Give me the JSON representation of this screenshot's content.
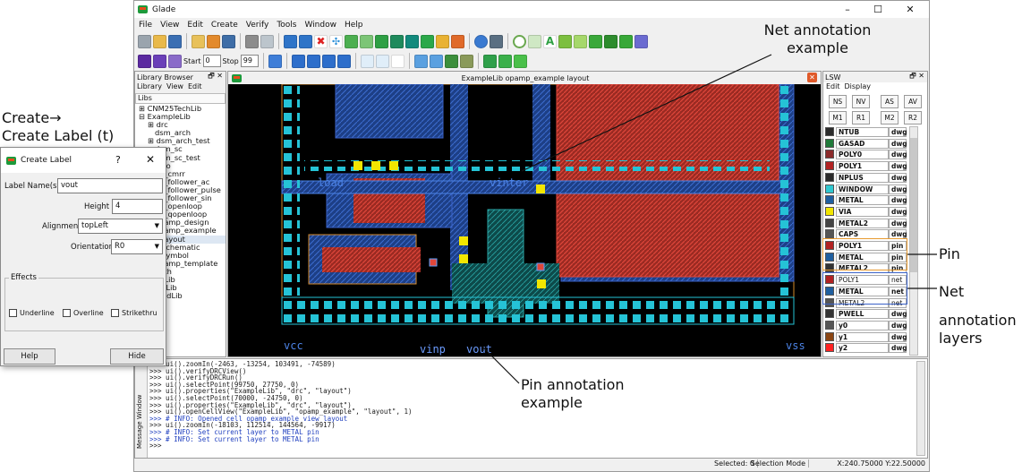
{
  "window": {
    "title": "Glade",
    "min": "–",
    "max": "☐",
    "close": "✕"
  },
  "menu": [
    "File",
    "View",
    "Edit",
    "Create",
    "Verify",
    "Tools",
    "Window",
    "Help"
  ],
  "toolbar": {
    "start_label": "Start",
    "start_value": "0",
    "stop_label": "Stop",
    "stop_value": "99"
  },
  "library_browser": {
    "title": "Library Browser",
    "pin": "🗗 ✕",
    "menu": [
      "Library",
      "View",
      "Edit"
    ],
    "libs_header": "Libs",
    "items": [
      "CNM25TechLib",
      "ExampleLib",
      "drc",
      "dsm_arch",
      "dsm_arch_test",
      "dsm_sc",
      "dsm_sc_test",
      "galo",
      "ga_cmrr",
      "ga_follower_ac",
      "ga_follower_pulse",
      "ga_follower_sin",
      "ga_openloop",
      "ga_qopenloop",
      "opamp_design",
      "opamp_example",
      "layout",
      "schematic",
      "symbol",
      "opamp_template",
      "path",
      "S3Lib",
      "oleLib",
      "medLib"
    ]
  },
  "canvas": {
    "title": "ExampleLib opamp_example layout",
    "labels": [
      "vinter",
      "load",
      "vcc",
      "vinp",
      "vout",
      "vss"
    ]
  },
  "lsw": {
    "title": "LSW",
    "menu": [
      "Edit",
      "Display"
    ],
    "buttons": [
      "NS",
      "NV",
      "AS",
      "AV",
      "M1",
      "R1",
      "M2",
      "R2"
    ],
    "layers": [
      {
        "name": "NTUB",
        "purpose": "dwg",
        "color": "#2b2b2b"
      },
      {
        "name": "GASAD",
        "purpose": "dwg",
        "color": "#1f7a3a"
      },
      {
        "name": "POLY0",
        "purpose": "dwg",
        "color": "#8b2a2a"
      },
      {
        "name": "POLY1",
        "purpose": "dwg",
        "color": "#b22222"
      },
      {
        "name": "NPLUS",
        "purpose": "dwg",
        "color": "#2a2a2a"
      },
      {
        "name": "WINDOW",
        "purpose": "dwg",
        "color": "#30c8d0"
      },
      {
        "name": "METAL",
        "purpose": "dwg",
        "color": "#1f5fa0"
      },
      {
        "name": "VIA",
        "purpose": "dwg",
        "color": "#f2e600"
      },
      {
        "name": "METAL2",
        "purpose": "dwg",
        "color": "#444444"
      },
      {
        "name": "CAPS",
        "purpose": "dwg",
        "color": "#555555"
      },
      {
        "name": "POLY1",
        "purpose": "pin",
        "color": "#b22222"
      },
      {
        "name": "METAL",
        "purpose": "pin",
        "color": "#1f5fa0"
      },
      {
        "name": "METAL2",
        "purpose": "pin",
        "color": "#333333"
      },
      {
        "name": "POLY1",
        "purpose": "net",
        "color": "#b22222"
      },
      {
        "name": "METAL",
        "purpose": "net",
        "color": "#1f5fa0"
      },
      {
        "name": "METAL2",
        "purpose": "net",
        "color": "#555555"
      },
      {
        "name": "PWELL",
        "purpose": "dwg",
        "color": "#333333"
      },
      {
        "name": "y0",
        "purpose": "dwg",
        "color": "#555555"
      },
      {
        "name": "y1",
        "purpose": "dwg",
        "color": "#8b4513"
      },
      {
        "name": "y2",
        "purpose": "dwg",
        "color": "#ff2222"
      }
    ]
  },
  "dialog": {
    "title": "Create Label",
    "help_q": "?",
    "close": "✕",
    "name_label": "Label Name(s)",
    "name_value": "vout",
    "height_label": "Height",
    "height_value": "4",
    "align_label": "Alignment",
    "align_value": "topLeft",
    "orient_label": "Orientation",
    "orient_value": "R0",
    "effects_label": "Effects",
    "underline": "Underline",
    "overline": "Overline",
    "strikethru": "Strikethru",
    "help_btn": "Help",
    "hide_btn": "Hide"
  },
  "console": {
    "side_label": "Message Window",
    "lines": [
      ">>> ui().zoomIn(-2463, -13254, 103491, -74589)",
      ">>> ui().verifyDRCView()",
      ">>> ui().verifyDRCRun()",
      ">>> ui().selectPoint(99750, 27750, 0)",
      ">>> ui().properties(\"ExampleLib\", \"drc\", \"layout\")",
      ">>> ui().selectPoint(70000, -24750, 0)",
      ">>> ui().properties(\"ExampleLib\", \"drc\", \"layout\")",
      ">>> ui().openCellView(\"ExampleLib\", \"opamp_example\", \"layout\", 1)",
      ">>> # INFO: Opened cell opamp_example view layout",
      ">>> ui().zoomIn(-18103, 112514, 144564, -9917)",
      ">>> # INFO: Set current layer to METAL pin",
      ">>> # INFO: Set current layer to METAL pin",
      ">>>"
    ]
  },
  "status": {
    "selected": "Selected: 0",
    "mode": "Selection Mode",
    "coords": "X:240.75000 Y:22.50000"
  },
  "annotations": {
    "create_label_1": "Create→",
    "create_label_2": "Create Label (t)",
    "net_example_1": "Net annotation",
    "net_example_2": "example",
    "pin": "Pin",
    "net": "Net",
    "net_layers_1": "annotation",
    "net_layers_2": "layers",
    "pin_example_1": "Pin annotation",
    "pin_example_2": "example"
  }
}
